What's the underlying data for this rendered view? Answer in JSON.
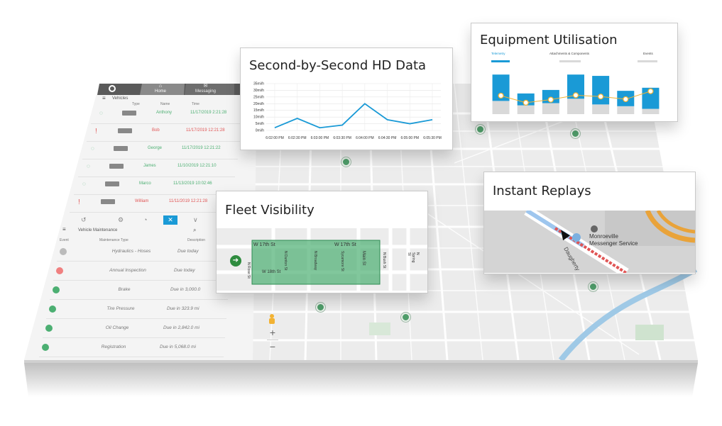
{
  "sidebar": {
    "tabs": [
      {
        "icon": "steering-wheel-icon",
        "label": ""
      },
      {
        "icon": "home-icon",
        "label": "Home"
      },
      {
        "icon": "messaging-icon",
        "label": "Messaging"
      }
    ],
    "vehicles_label": "Vehicles",
    "columns": [
      "",
      "Type",
      "Name",
      "Time"
    ],
    "vehicles": [
      {
        "status": "ok",
        "name": "Anthony",
        "time": "11/17/2019 2:21:28"
      },
      {
        "status": "alert",
        "name": "Bob",
        "time": "11/17/2019 12:21:28"
      },
      {
        "status": "ok",
        "name": "George",
        "time": "11/17/2019 12:21:22"
      },
      {
        "status": "ok",
        "name": "James",
        "time": "11/10/2019 12:21:10"
      },
      {
        "status": "ok",
        "name": "Marco",
        "time": "11/13/2019 10:02:46"
      },
      {
        "status": "alert",
        "name": "William",
        "time": "11/11/2019 12:21:28"
      }
    ],
    "maintenance_label": "Vehicle Maintenance",
    "maintenance_columns": [
      "Event",
      "Maintenance Type",
      "Description"
    ],
    "maintenance": [
      {
        "status": "neutral",
        "type": "Hydraulics - Hoses",
        "desc": "Due today"
      },
      {
        "status": "alert",
        "type": "Annual Inspection",
        "desc": "Due today"
      },
      {
        "status": "ok",
        "type": "Brake",
        "desc": "Due in 3,000.0"
      },
      {
        "status": "ok",
        "type": "Tire Pressure",
        "desc": "Due in 323.9 mi"
      },
      {
        "status": "ok",
        "type": "Oil Change",
        "desc": "Due in 2,842.0 mi"
      },
      {
        "status": "ok",
        "type": "Registration",
        "desc": "Due in 5,068.0 mi"
      }
    ]
  },
  "map_controls": {
    "zoom_in": "+",
    "zoom_out": "−"
  },
  "hd_data": {
    "title": "Second-by-Second HD Data",
    "y_ticks": [
      "35mi/h",
      "30mi/h",
      "25mi/h",
      "20mi/h",
      "15mi/h",
      "10mi/h",
      "5mi/h",
      "0mi/h"
    ],
    "chart_data": {
      "type": "line",
      "x": [
        "6:02:00 PM",
        "6:02:30 PM",
        "6:03:00 PM",
        "6:03:30 PM",
        "6:04:00 PM",
        "6:04:30 PM",
        "6:05:00 PM",
        "6:05:30 PM"
      ],
      "values": [
        2,
        9,
        2,
        4,
        20,
        8,
        5,
        8
      ],
      "ylim": [
        0,
        35
      ],
      "color": "#1a9ad6"
    }
  },
  "equipment": {
    "title": "Equipment Utilisation",
    "legend": [
      "Telemetry",
      "Attachments & Components",
      "Events"
    ],
    "chart_data": {
      "type": "bar",
      "series": [
        {
          "values": [
            60,
            27,
            30,
            55,
            65,
            35,
            48
          ],
          "color": "#1a9ad6"
        },
        {
          "values": [
            30,
            20,
            25,
            35,
            22,
            18,
            12
          ],
          "color": "#d9d9d9"
        }
      ],
      "line": {
        "values": [
          42,
          26,
          33,
          43,
          40,
          34,
          52
        ],
        "color": "#f2b233"
      },
      "ylim": [
        0,
        100
      ]
    }
  },
  "fleet": {
    "title": "Fleet Visibility",
    "streets": [
      "W 17th St",
      "W 17th St",
      "N Rose St",
      "W 18th St",
      "N Dunton St",
      "N Broadway",
      "Sycamore St",
      "Main St",
      "N Bush St",
      "N Spring St"
    ]
  },
  "replays": {
    "title": "Instant Replays",
    "place": "Monroeville Messenger Service",
    "street": "Daugherty"
  },
  "colors": {
    "ok": "#4caf72",
    "alert": "#e05555",
    "accent": "#1a9ad6",
    "geofence": "#4caf72"
  }
}
